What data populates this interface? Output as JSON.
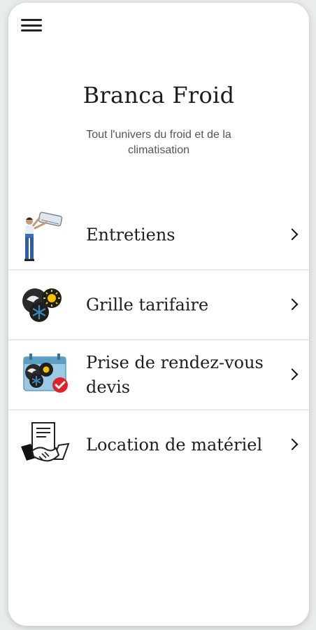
{
  "header": {
    "menu_icon": "hamburger-menu-icon",
    "title": "Branca Froid",
    "subtitle": "Tout l'univers du froid et de la climatisation"
  },
  "menu": {
    "items": [
      {
        "label": "Entretiens",
        "icon": "technician-ac-unit-icon"
      },
      {
        "label": "Grille tarifaire",
        "icon": "hot-cold-pricing-icon"
      },
      {
        "label": "Prise de rendez-vous devis",
        "icon": "calendar-appointment-icon"
      },
      {
        "label": "Location de matériel",
        "icon": "handshake-contract-icon"
      }
    ],
    "chevron_icon": "chevron-right-icon"
  },
  "colors": {
    "background": "#ffffff",
    "text": "#1e1e1e",
    "subtitle": "#555555",
    "divider": "#dcdcdc",
    "accent_red": "#e0202a",
    "accent_blue": "#3a86b8",
    "accent_yellow": "#f2c200"
  }
}
